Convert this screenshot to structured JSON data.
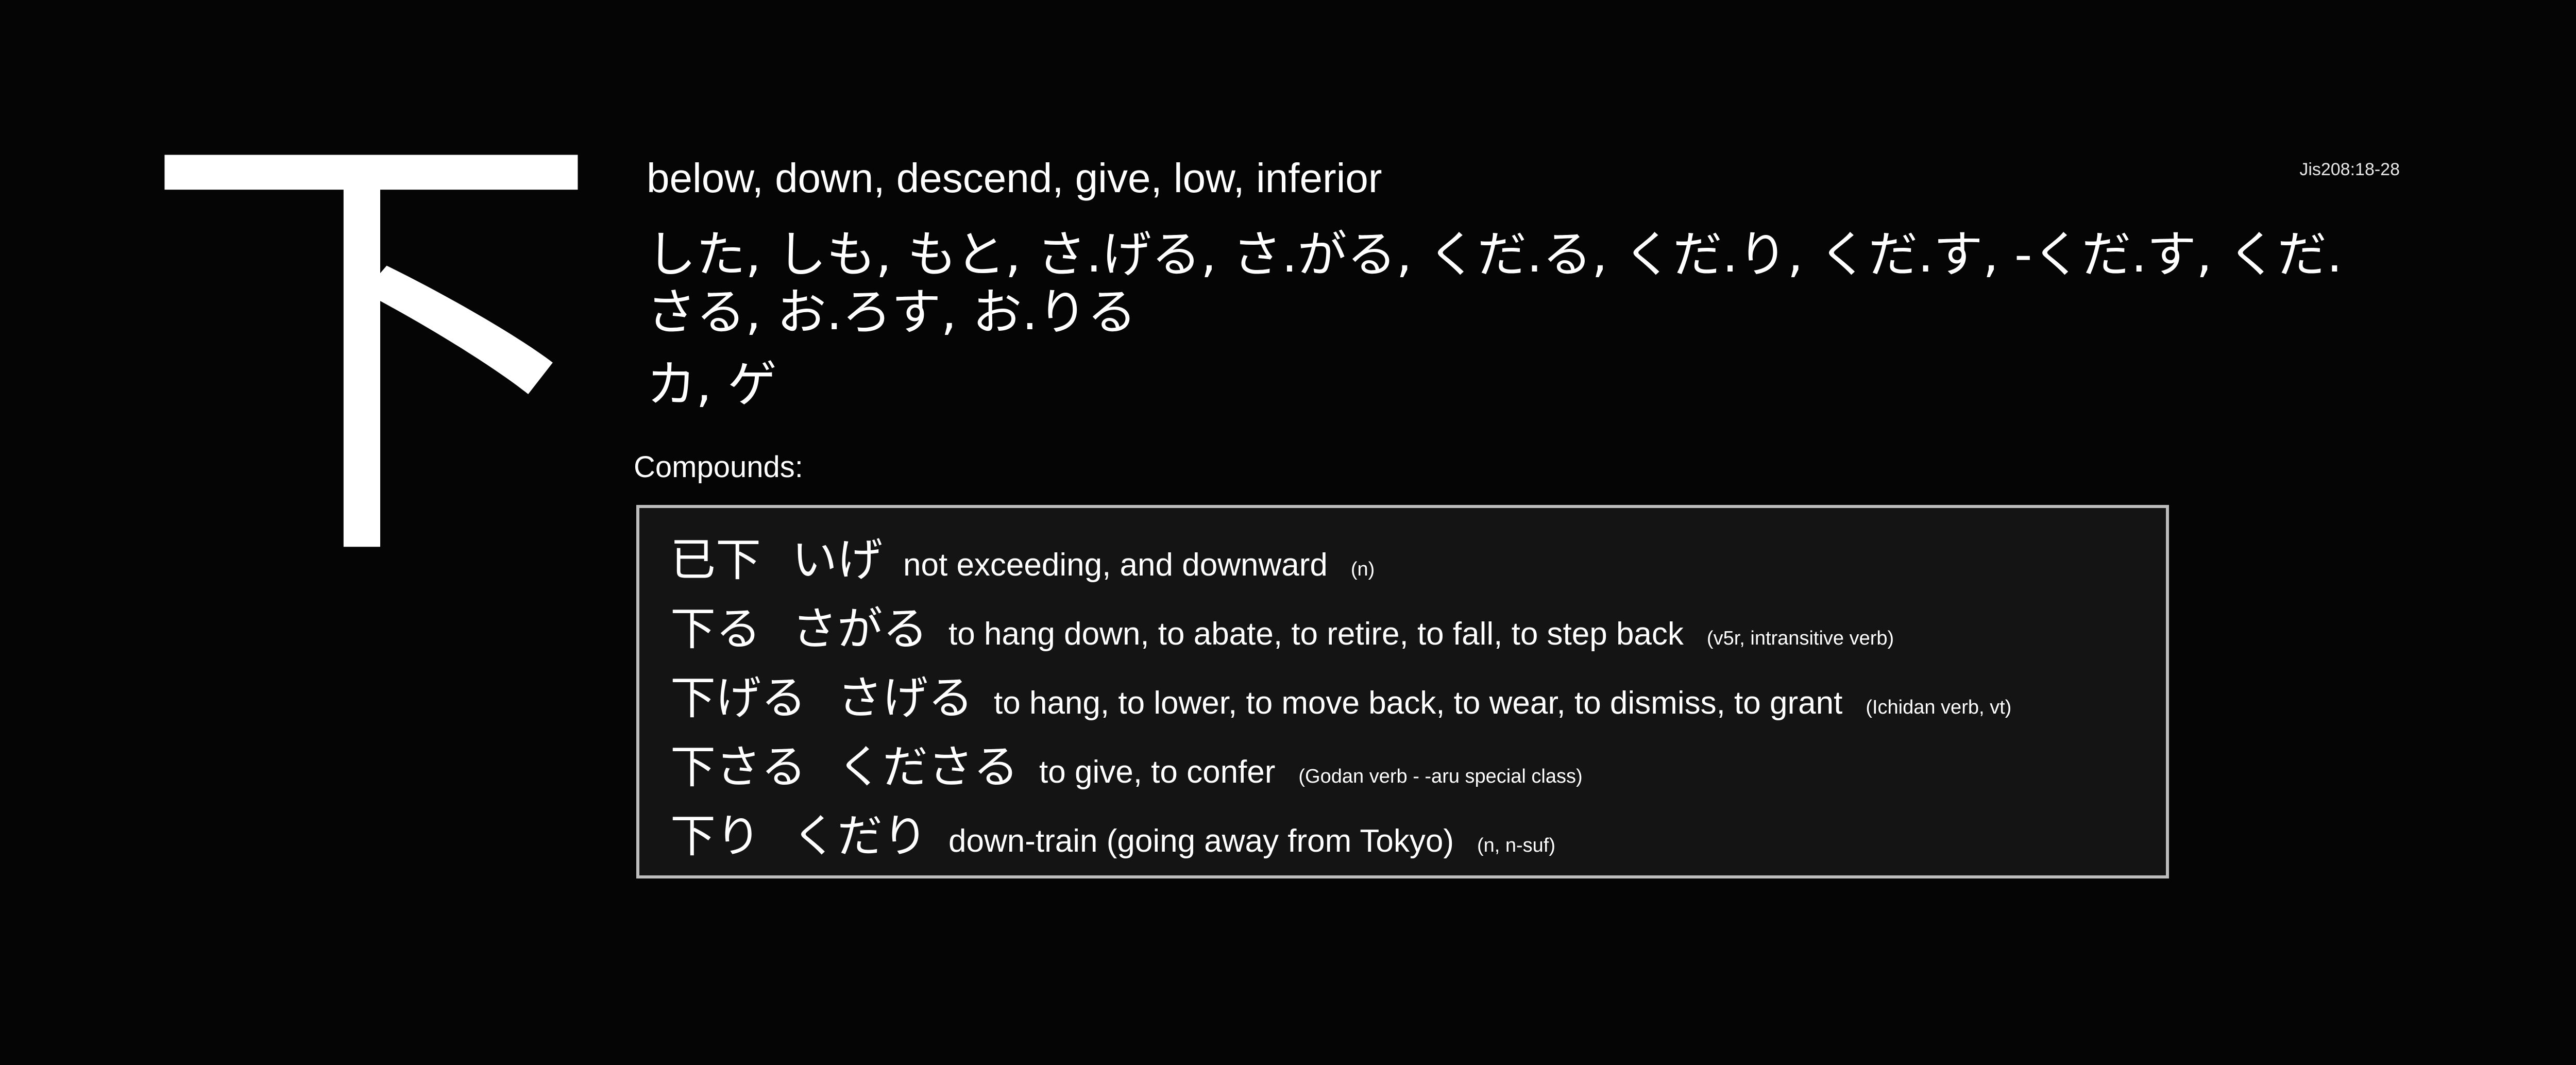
{
  "kanji": "下",
  "jis_code": "Jis208:18-28",
  "meanings": "below, down, descend, give, low, inferior",
  "kun_readings": "した, しも, もと, さ.げる, さ.がる, くだ.る, くだ.り, くだ.す, -くだ.す, くだ.さる, お.ろす, お.りる",
  "on_readings": "カ, ゲ",
  "compounds_label": "Compounds:",
  "compounds": [
    {
      "word": "已下",
      "reading": "いげ",
      "meaning": "not exceeding, and downward",
      "pos": "(n)"
    },
    {
      "word": "下る",
      "reading": "さがる",
      "meaning": "to hang down, to abate, to retire, to fall, to step back",
      "pos": "(v5r, intransitive verb)"
    },
    {
      "word": "下げる",
      "reading": "さげる",
      "meaning": "to hang, to lower, to move back, to wear, to dismiss, to grant",
      "pos": "(Ichidan verb, vt)"
    },
    {
      "word": "下さる",
      "reading": "くださる",
      "meaning": "to give, to confer",
      "pos": "(Godan verb - -aru special class)"
    },
    {
      "word": "下り",
      "reading": "くだり",
      "meaning": "down-train (going away from Tokyo)",
      "pos": "(n, n-suf)"
    }
  ]
}
